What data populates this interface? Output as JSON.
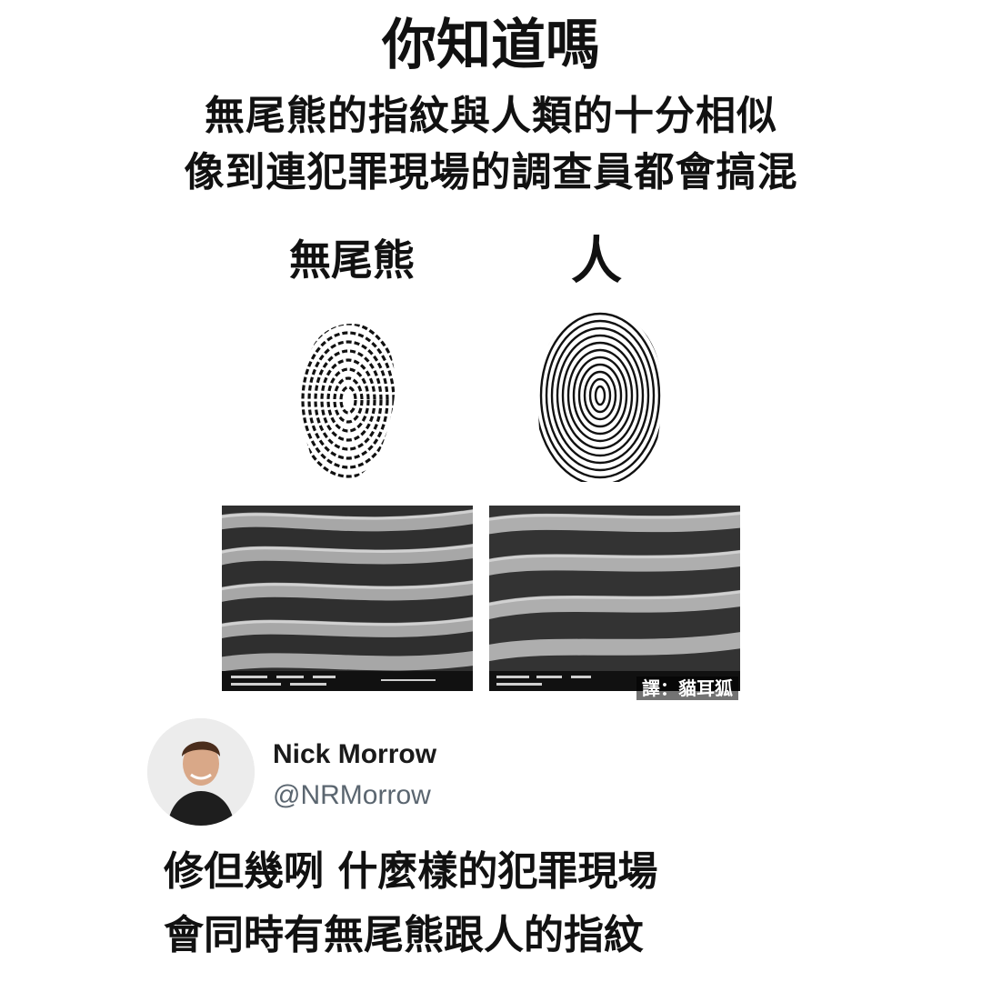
{
  "header": {
    "title": "你知道嗎",
    "subtitle_line1": "無尾熊的指紋與人類的十分相似",
    "subtitle_line2": "像到連犯罪現場的調查員都會搞混"
  },
  "comparison": {
    "left_label": "無尾熊",
    "right_label": "人",
    "credit": "譯：貓耳狐"
  },
  "tweet": {
    "author_name": "Nick Morrow",
    "author_handle": "@NRMorrow",
    "text_line1": "修但幾咧 什麼樣的犯罪現場",
    "text_line2": "會同時有無尾熊跟人的指紋"
  },
  "colors": {
    "text": "#111111",
    "handle": "#5b6670",
    "background": "#ffffff"
  }
}
